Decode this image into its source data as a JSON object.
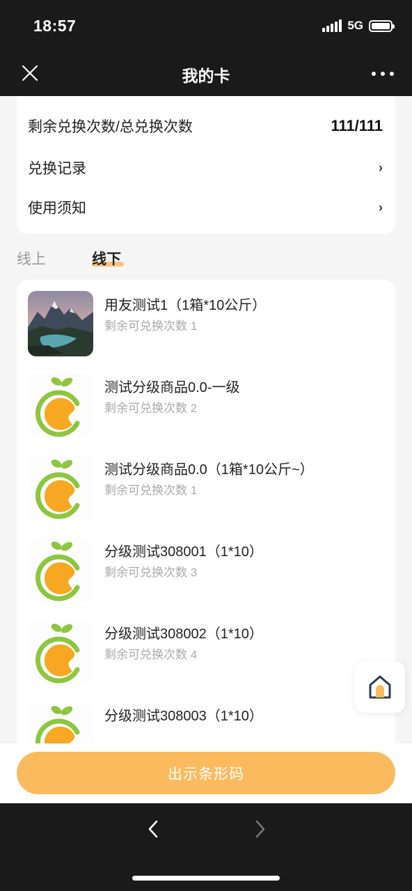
{
  "status_bar": {
    "time": "18:57",
    "network": "5G"
  },
  "header": {
    "title": "我的卡"
  },
  "card_info": {
    "remaining_label": "剩余兑换次数/总兑换次数",
    "remaining_value": "111/111",
    "records_label": "兑换记录",
    "notice_label": "使用须知",
    "chevron": "›"
  },
  "tabs": [
    {
      "label": "线上",
      "active": false
    },
    {
      "label": "线下",
      "active": true
    }
  ],
  "items": [
    {
      "name": "用友测试1（1箱*10公斤）",
      "remaining": "剩余可兑换次数 1",
      "image": "mountain-lake-photo"
    },
    {
      "name": "测试分级商品0.0-一级",
      "remaining": "剩余可兑换次数 2",
      "image": "orange-logo"
    },
    {
      "name": "测试分级商品0.0（1箱*10公斤~）",
      "remaining": "剩余可兑换次数 1",
      "image": "orange-logo"
    },
    {
      "name": "分级测试308001（1*10）",
      "remaining": "剩余可兑换次数 3",
      "image": "orange-logo"
    },
    {
      "name": "分级测试308002（1*10）",
      "remaining": "剩余可兑换次数 4",
      "image": "orange-logo"
    },
    {
      "name": "分级测试308003（1*10）",
      "remaining": "",
      "image": "orange-logo"
    }
  ],
  "actions": {
    "barcode_button": "出示条形码"
  },
  "colors": {
    "accent": "#fbba5e",
    "tab_underline": "#fbc47a",
    "dark_bar": "#1a1a1a"
  }
}
